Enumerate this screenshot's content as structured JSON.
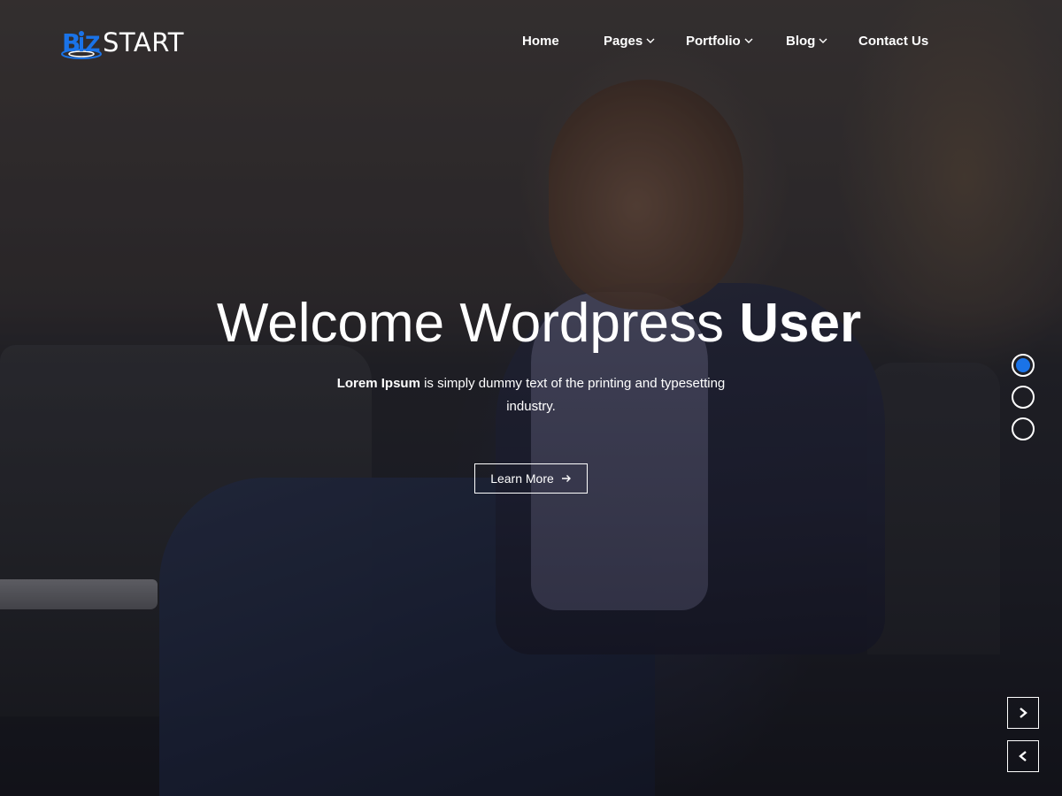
{
  "brand": {
    "logo_text": "START",
    "logo_mark_letters": "BIZ",
    "accent_color": "#1a73e8"
  },
  "nav": {
    "items": [
      {
        "label": "Home",
        "has_dropdown": false
      },
      {
        "label": "Pages",
        "has_dropdown": true
      },
      {
        "label": "Portfolio",
        "has_dropdown": true
      },
      {
        "label": "Blog",
        "has_dropdown": true
      },
      {
        "label": "Contact Us",
        "has_dropdown": false
      }
    ]
  },
  "hero": {
    "title_light": "Welcome Wordpress ",
    "title_bold": "User",
    "desc_bold": "Lorem Ipsum",
    "desc_rest": " is simply dummy text of the printing and typesetting industry.",
    "button_label": "Learn More",
    "button_icon": "arrow-right-icon"
  },
  "slider": {
    "dots": 3,
    "active_index": 0,
    "next_icon": "chevron-right-icon",
    "prev_icon": "chevron-left-icon"
  }
}
